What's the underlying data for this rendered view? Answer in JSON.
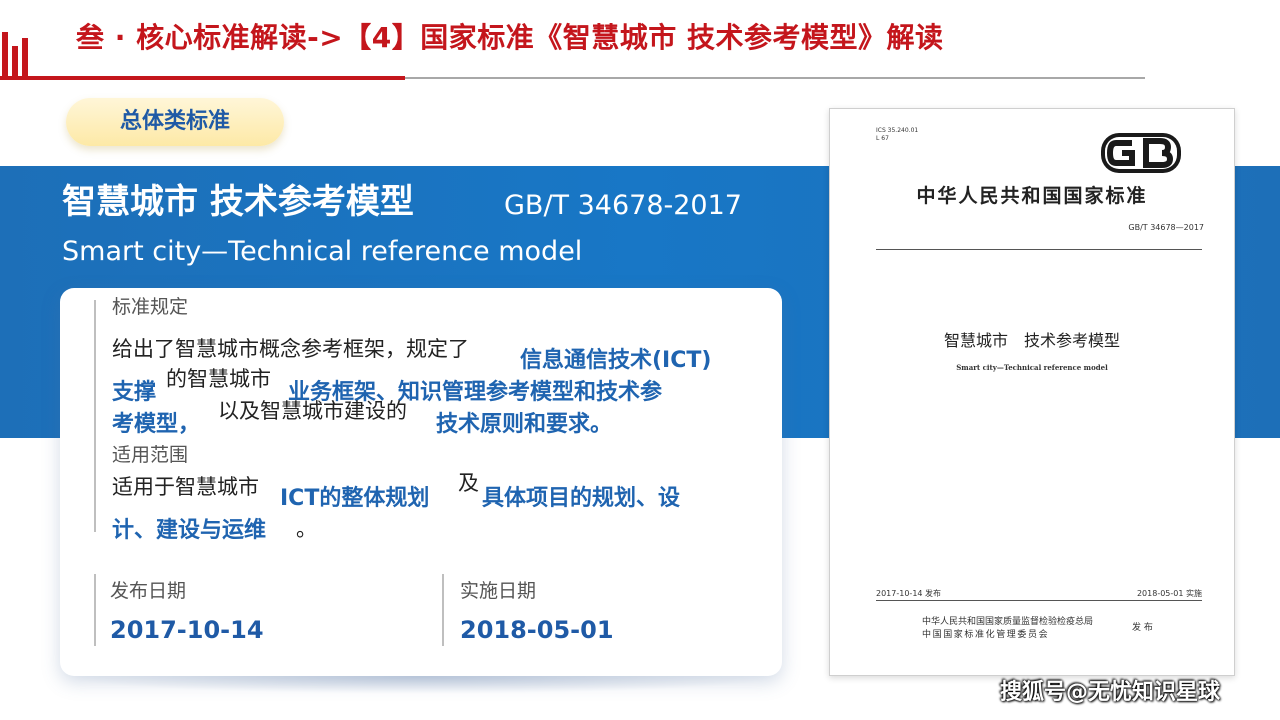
{
  "header": {
    "title": "叁 · 核心标准解读->【4】国家标准《智慧城市 技术参考模型》解读"
  },
  "badge": {
    "label": "总体类标准"
  },
  "standard": {
    "title_cn": "智慧城市 技术参考模型",
    "code": "GB/T 34678-2017",
    "title_en": "Smart city—Technical reference model"
  },
  "card": {
    "provisions": {
      "label": "标准规定",
      "t1": "给出了智慧城市概念参考框架，规定了",
      "h1": "信息通信技术(ICT)",
      "h2": "支撑",
      "t2": "的智慧城市",
      "h3": "业务框架、知识管理参考模型和技术参",
      "h4": "考模型，",
      "t3": "以及智慧城市建设的",
      "h5": "技术原则和要求。"
    },
    "scope": {
      "label": "适用范围",
      "t1": "适用于智慧城市",
      "h1": "ICT的整体规划",
      "t2": "及",
      "h2": "具体项目的规划、设",
      "h3": "计、建设与运维",
      "t3": "。"
    },
    "release": {
      "label": "发布日期",
      "value": "2017-10-14"
    },
    "implement": {
      "label": "实施日期",
      "value": "2018-05-01"
    }
  },
  "document": {
    "ics": "ICS 35.240.01",
    "ccs": "L 67",
    "heading": "中华人民共和国国家标准",
    "code": "GB/T 34678—2017",
    "title": "智慧城市　技术参考模型",
    "subtitle": "Smart city—Technical reference model",
    "release": "2017-10-14 发布",
    "implement": "2018-05-01 实施",
    "publisher1": "中华人民共和国国家质量监督检验检疫总局",
    "publisher2": "中国国家标准化管理委员会",
    "publish": "发 布"
  },
  "watermark": "搜狐号@无忧知识星球",
  "colors": {
    "accent_red": "#c4161c",
    "band_blue": "#1877c6",
    "highlight_blue": "#1f64b0",
    "badge_yellow": "#fde9a6"
  }
}
